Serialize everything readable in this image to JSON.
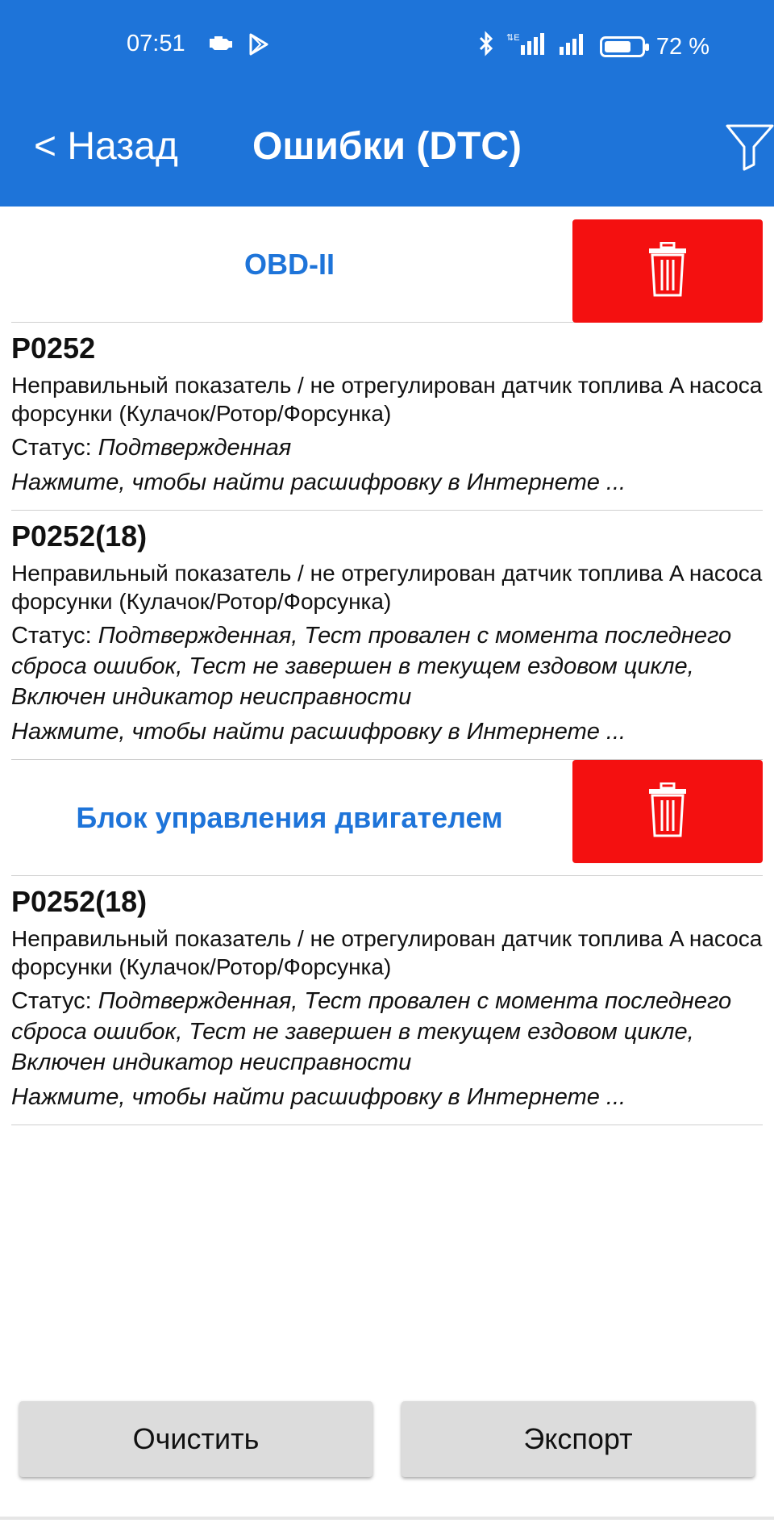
{
  "status_bar": {
    "time": "07:51",
    "icons_left": [
      "engine-icon",
      "play-store-icon"
    ],
    "icons_right": [
      "bluetooth-icon",
      "signal-e-icon",
      "signal-icon"
    ],
    "battery_percent_label": "72 %",
    "battery_level": 0.72
  },
  "header": {
    "back_label": "< Назад",
    "title": "Ошибки (DTC)",
    "filter_icon": "filter-icon",
    "background_color": "#1e74d9"
  },
  "sections": [
    {
      "title": "OBD-II",
      "delete_icon": "trash-icon",
      "items": [
        {
          "code": "P0252",
          "description": "Неправильный показатель / не отрегулирован датчик топлива A насоса форсунки (Кулачок/Ротор/Форсунка)",
          "status_label": "Статус:",
          "status_value": "Подтвержденная",
          "link": "Нажмите, чтобы найти расшифровку в Интернете ..."
        },
        {
          "code": "P0252(18)",
          "description": "Неправильный показатель / не отрегулирован датчик топлива A насоса форсунки (Кулачок/Ротор/Форсунка)",
          "status_label": "Статус:",
          "status_value": "Подтвержденная, Тест провален с момента последнего сброса ошибок, Тест не завершен в текущем ездовом цикле, Включен индикатор неисправности",
          "link": "Нажмите, чтобы найти расшифровку в Интернете ..."
        }
      ]
    },
    {
      "title": "Блок управления двигателем",
      "delete_icon": "trash-icon",
      "items": [
        {
          "code": "P0252(18)",
          "description": "Неправильный показатель / не отрегулирован датчик топлива A насоса форсунки (Кулачок/Ротор/Форсунка)",
          "status_label": "Статус:",
          "status_value": "Подтвержденная, Тест провален с момента последнего сброса ошибок, Тест не завершен в текущем ездовом цикле, Включен индикатор неисправности",
          "link": "Нажмите, чтобы найти расшифровку в Интернете ..."
        }
      ]
    }
  ],
  "footer": {
    "clear_label": "Очистить",
    "export_label": "Экспорт"
  },
  "colors": {
    "accent": "#1e74d9",
    "delete": "#f41010",
    "button": "#dcdcdc"
  }
}
